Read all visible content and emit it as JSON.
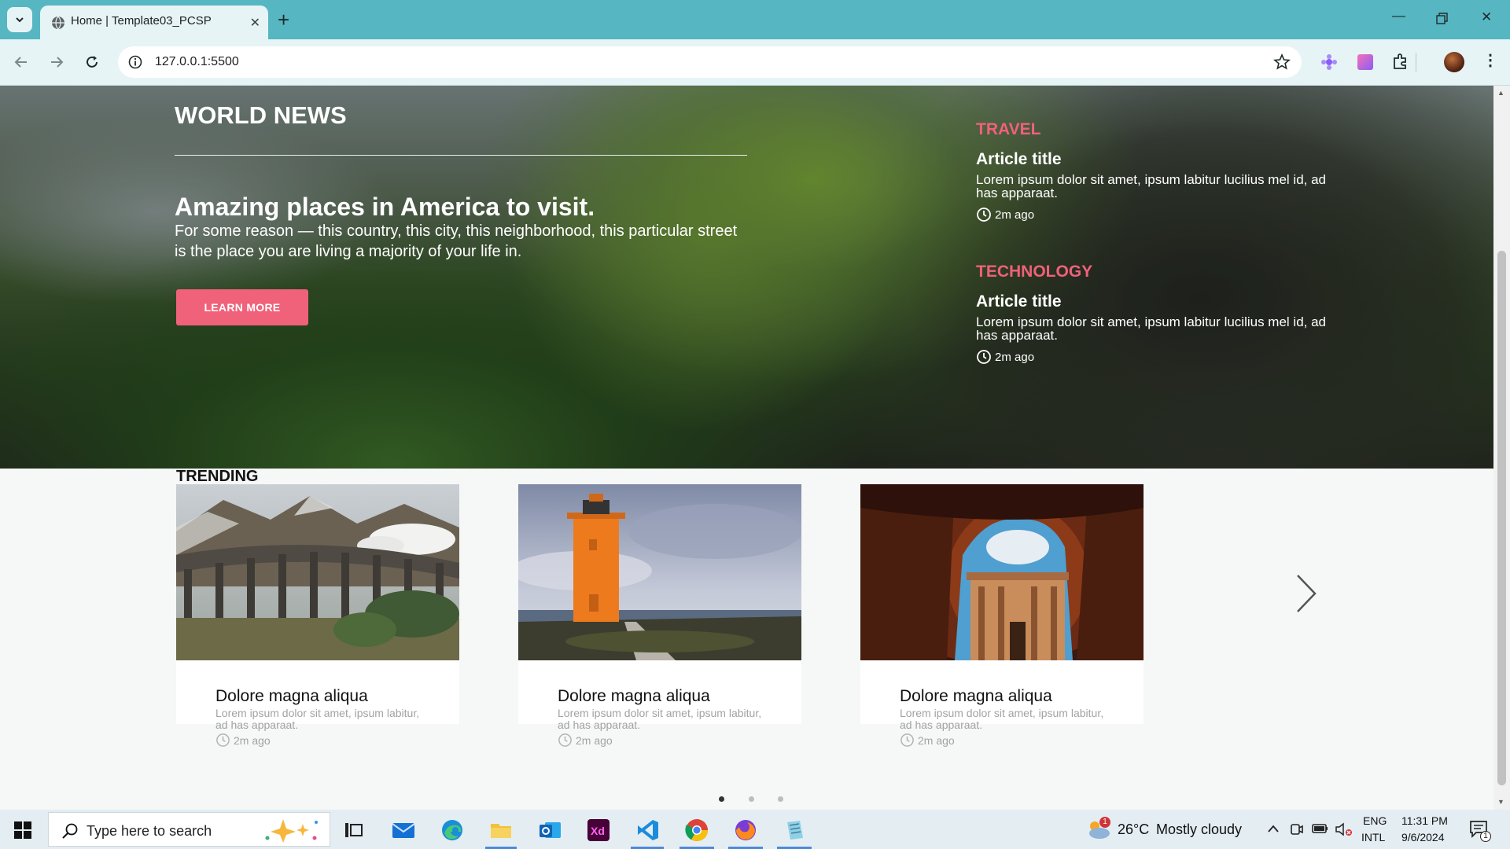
{
  "browser": {
    "tab_title": "Home | Template03_PCSP",
    "url": "127.0.0.1:5500"
  },
  "hero": {
    "section_title": "WORLD NEWS",
    "headline": "Amazing places in America to visit.",
    "lead": "For some reason — this country, this city, this neighborhood, this particular street is the place you are living a majority of your life in.",
    "button": "LEARN MORE",
    "side_articles": [
      {
        "category": "TRAVEL",
        "title": "Article title",
        "body": "Lorem ipsum dolor sit amet, ipsum labitur lucilius mel id, ad has apparaat.",
        "time": "2m ago"
      },
      {
        "category": "TECHNOLOGY",
        "title": "Article title",
        "body": "Lorem ipsum dolor sit amet, ipsum labitur lucilius mel id, ad has apparaat.",
        "time": "2m ago"
      }
    ]
  },
  "trending": {
    "label": "TRENDING",
    "cards": [
      {
        "title": "Dolore magna aliqua",
        "body": "Lorem ipsum dolor sit amet, ipsum labitur, ad has apparaat.",
        "time": "2m ago",
        "image": "viaduct-train-photo"
      },
      {
        "title": "Dolore magna aliqua",
        "body": "Lorem ipsum dolor sit amet, ipsum labitur, ad has apparaat.",
        "time": "2m ago",
        "image": "orange-lighthouse-photo"
      },
      {
        "title": "Dolore magna aliqua",
        "body": "Lorem ipsum dolor sit amet, ipsum labitur, ad has apparaat.",
        "time": "2m ago",
        "image": "petra-treasury-photo"
      }
    ],
    "carousel_pages": 3,
    "active_page": 1
  },
  "taskbar": {
    "search_placeholder": "Type here to search",
    "weather_temp": "26°C",
    "weather_text": "Mostly cloudy",
    "weather_badge": "1",
    "lang_top": "ENG",
    "lang_bottom": "INTL",
    "time": "11:31 PM",
    "date": "9/6/2024",
    "notification_count": "1"
  },
  "colors": {
    "accent_pink": "#f0617a",
    "tab_strip": "#56b6c2"
  }
}
